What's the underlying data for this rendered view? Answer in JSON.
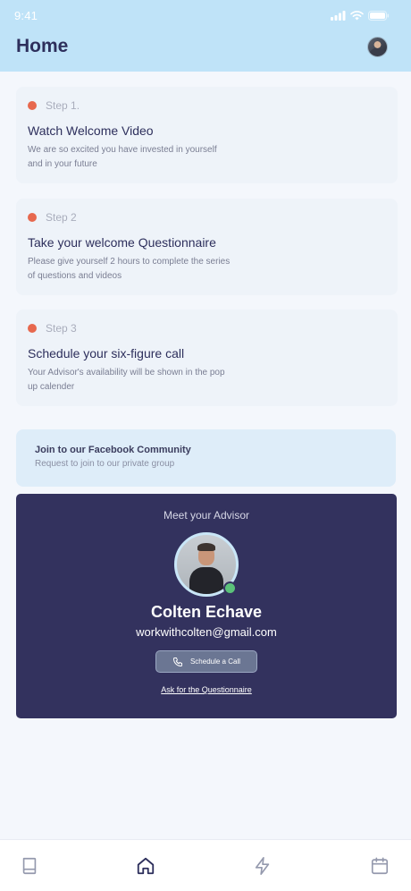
{
  "status": {
    "time": "9:41"
  },
  "header": {
    "title": "Home"
  },
  "steps": [
    {
      "label": "Step 1.",
      "title": "Watch Welcome Video",
      "description": "We are so excited you have invested in yourself and in your future"
    },
    {
      "label": "Step 2",
      "title": "Take your welcome Questionnaire",
      "description": "Please give yourself 2 hours to complete the series of questions and videos"
    },
    {
      "label": "Step 3",
      "title": "Schedule your six-figure call",
      "description": "Your Advisor's availability will be shown in the pop up calender"
    }
  ],
  "facebook": {
    "title": "Join to our Facebook Community",
    "subtitle": "Request to join to our private group"
  },
  "advisor": {
    "heading": "Meet your Advisor",
    "name": "Colten Echave",
    "email": "workwithcolten@gmail.com",
    "call_button": "Schedule a Call",
    "questionnaire_link": "Ask for the Questionnaire"
  },
  "nav": {
    "items": [
      {
        "icon": "book-icon",
        "active": false
      },
      {
        "icon": "home-icon",
        "active": true
      },
      {
        "icon": "lightning-icon",
        "active": false
      },
      {
        "icon": "calendar-icon",
        "active": false
      }
    ]
  },
  "colors": {
    "header_bg": "#bfe3f8",
    "step_dot": "#e7684e",
    "advisor_bg": "#33325e",
    "online": "#5bc27a",
    "title": "#2d2f5c"
  }
}
